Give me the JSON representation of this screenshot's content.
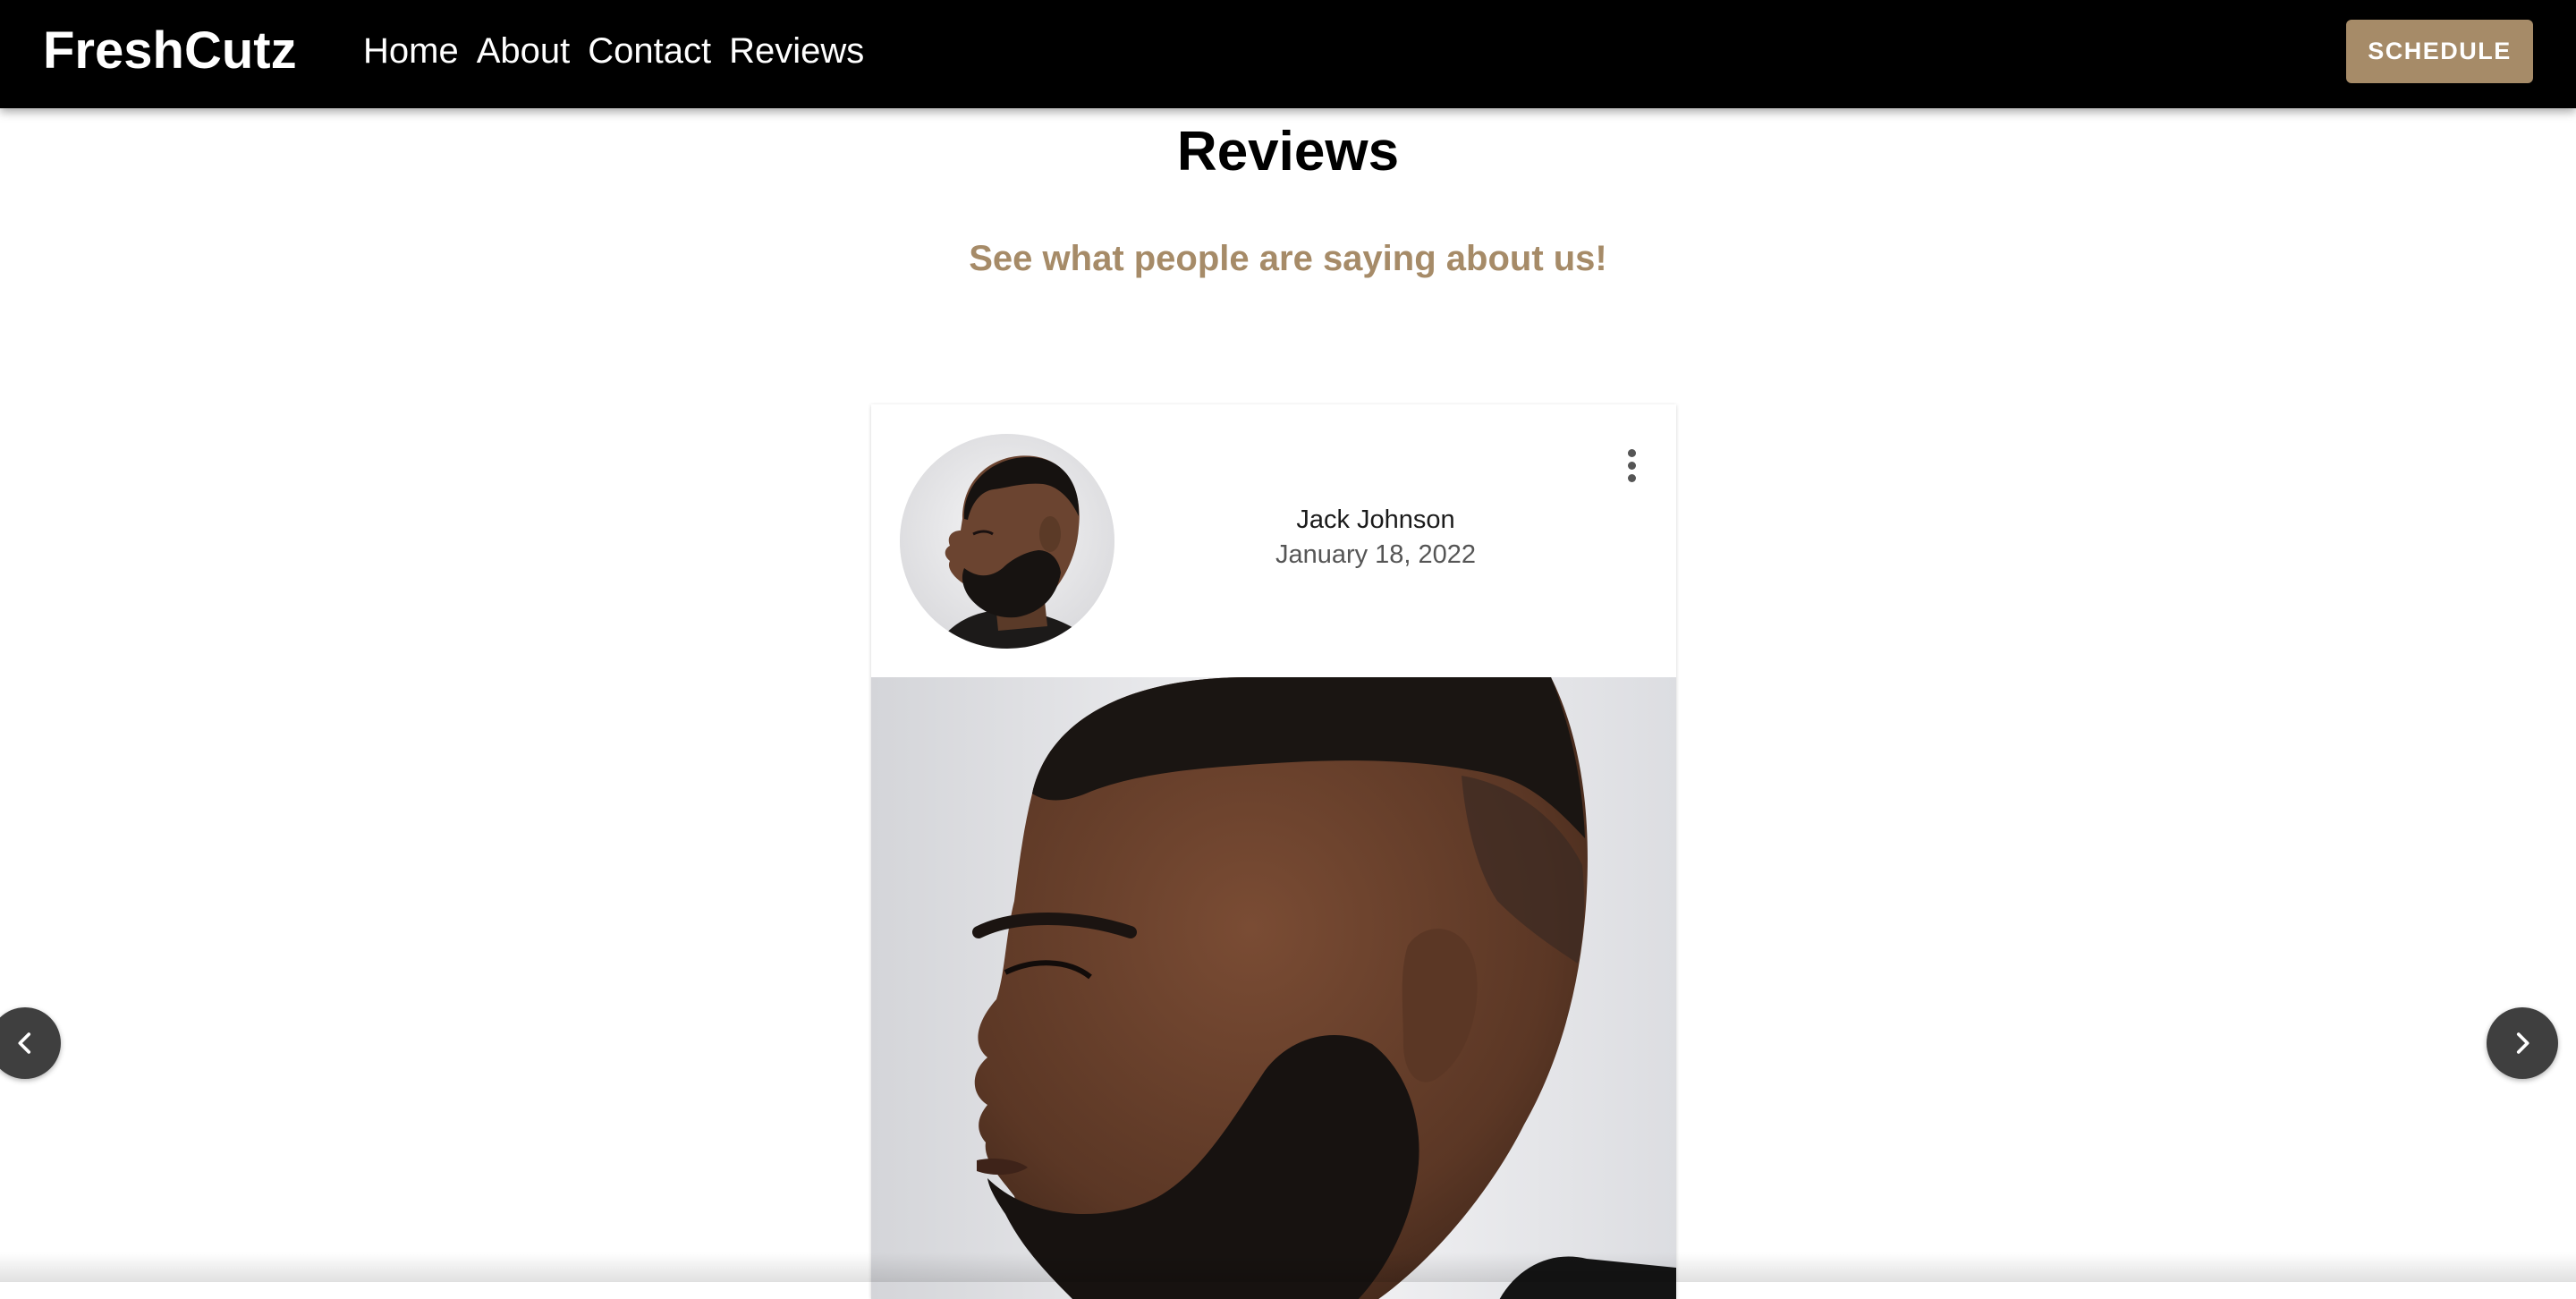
{
  "navbar": {
    "brand": "FreshCutz",
    "links": [
      {
        "label": "Home"
      },
      {
        "label": "About"
      },
      {
        "label": "Contact"
      },
      {
        "label": "Reviews"
      }
    ],
    "schedule_label": "SCHEDULE"
  },
  "page": {
    "title": "Reviews",
    "subtitle": "See what people are saying about us!"
  },
  "review": {
    "name": "Jack Johnson",
    "date": "January 18, 2022",
    "menu_icon": "more-vertical-icon",
    "avatar_alt": "Jack Johnson profile photo",
    "photo_alt": "Side profile of a man with a fresh fade haircut and beard"
  },
  "carousel": {
    "prev_icon": "chevron-left-icon",
    "next_icon": "chevron-right-icon"
  },
  "colors": {
    "nav_bg": "#000000",
    "accent": "#a68b68",
    "arrow_bg": "#3f3f3f"
  }
}
